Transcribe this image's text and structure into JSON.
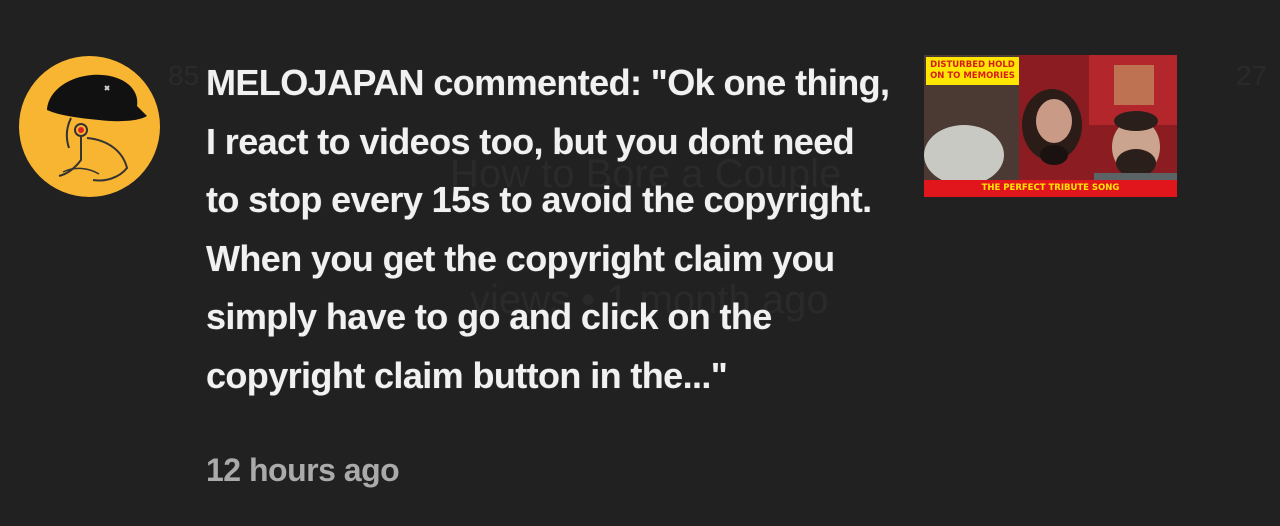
{
  "background": {
    "left_count": "85",
    "right_count": "27",
    "video_title": "How to Bore a Couple",
    "video_meta": "views • 1 month ago"
  },
  "comment": {
    "author": "MELOJAPAN",
    "text": "MELOJAPAN commented: \"Ok one thing, I react to videos too, but you dont need to stop every 15s to avoid the copyright. When you get the copyright claim you simply have to go and click on the copyright claim button in the...\"",
    "timestamp": "12 hours ago"
  },
  "thumbnail": {
    "label": "DISTURBED HOLD ON TO MEMORIES",
    "banner": "THE PERFECT TRIBUTE SONG"
  },
  "colors": {
    "background": "#212121",
    "text": "#f1f1f1",
    "secondary_text": "#aaaaaa",
    "avatar_bg": "#f8b531"
  }
}
